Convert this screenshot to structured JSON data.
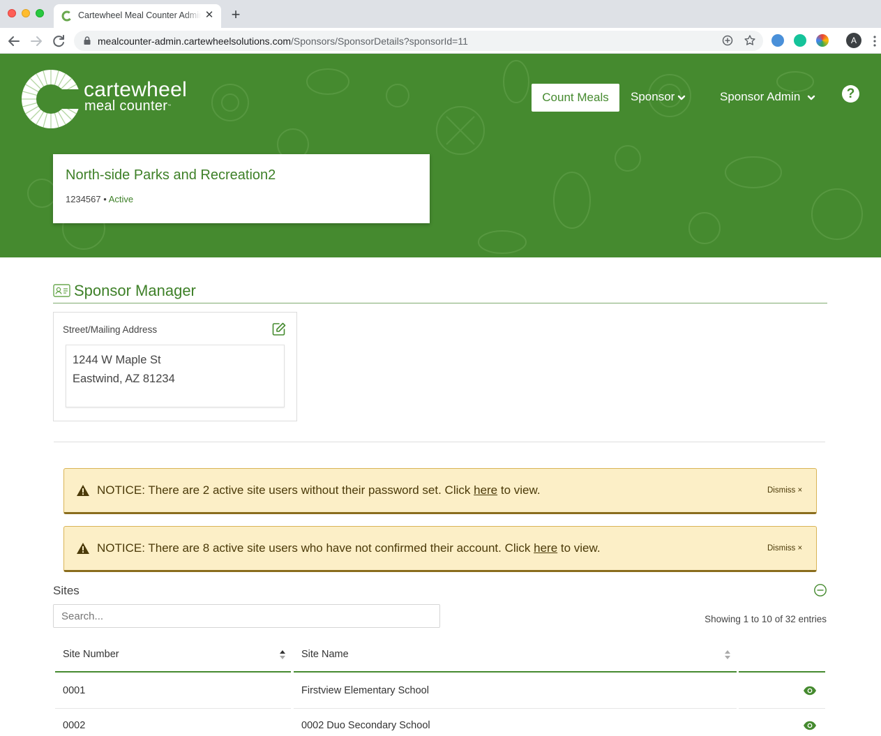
{
  "browser": {
    "tab_title": "Cartewheel Meal Counter Admin",
    "url_host": "mealcounter-admin.cartewheelsolutions.com",
    "url_path": "/Sponsors/SponsorDetails?sponsorId=11",
    "profile_initial": "A"
  },
  "colors": {
    "brand_green": "#458a2f",
    "notice_bg": "#fcefc7"
  },
  "header": {
    "brand_line1": "cartewheel",
    "brand_line2": "meal counter",
    "brand_tm": "™",
    "count_meals": "Count Meals",
    "menu_sponsor": "Sponsor",
    "menu_sponsor_admin": "Sponsor Admin",
    "help": "?"
  },
  "sponsor": {
    "name": "North-side Parks and Recreation2",
    "id": "1234567",
    "separator": " • ",
    "status": "Active"
  },
  "manager": {
    "title": "Sponsor Manager",
    "address_label": "Street/Mailing Address",
    "address_line1": "1244 W Maple St",
    "address_line2": "Eastwind, AZ 81234"
  },
  "notices": [
    {
      "before": "NOTICE: There are 2 active site users without their password set. Click ",
      "link": "here",
      "after": " to view.",
      "dismiss": "Dismiss ×"
    },
    {
      "before": "NOTICE: There are 8 active site users who have not confirmed their account. Click ",
      "link": "here",
      "after": " to view.",
      "dismiss": "Dismiss ×"
    }
  ],
  "sites": {
    "title": "Sites",
    "search_placeholder": "Search...",
    "showing": "Showing 1 to 10 of 32 entries",
    "columns": [
      "Site Number",
      "Site Name",
      ""
    ],
    "rows": [
      {
        "number": "0001",
        "name": "Firstview Elementary School"
      },
      {
        "number": "0002",
        "name": "0002 Duo Secondary School"
      }
    ]
  }
}
